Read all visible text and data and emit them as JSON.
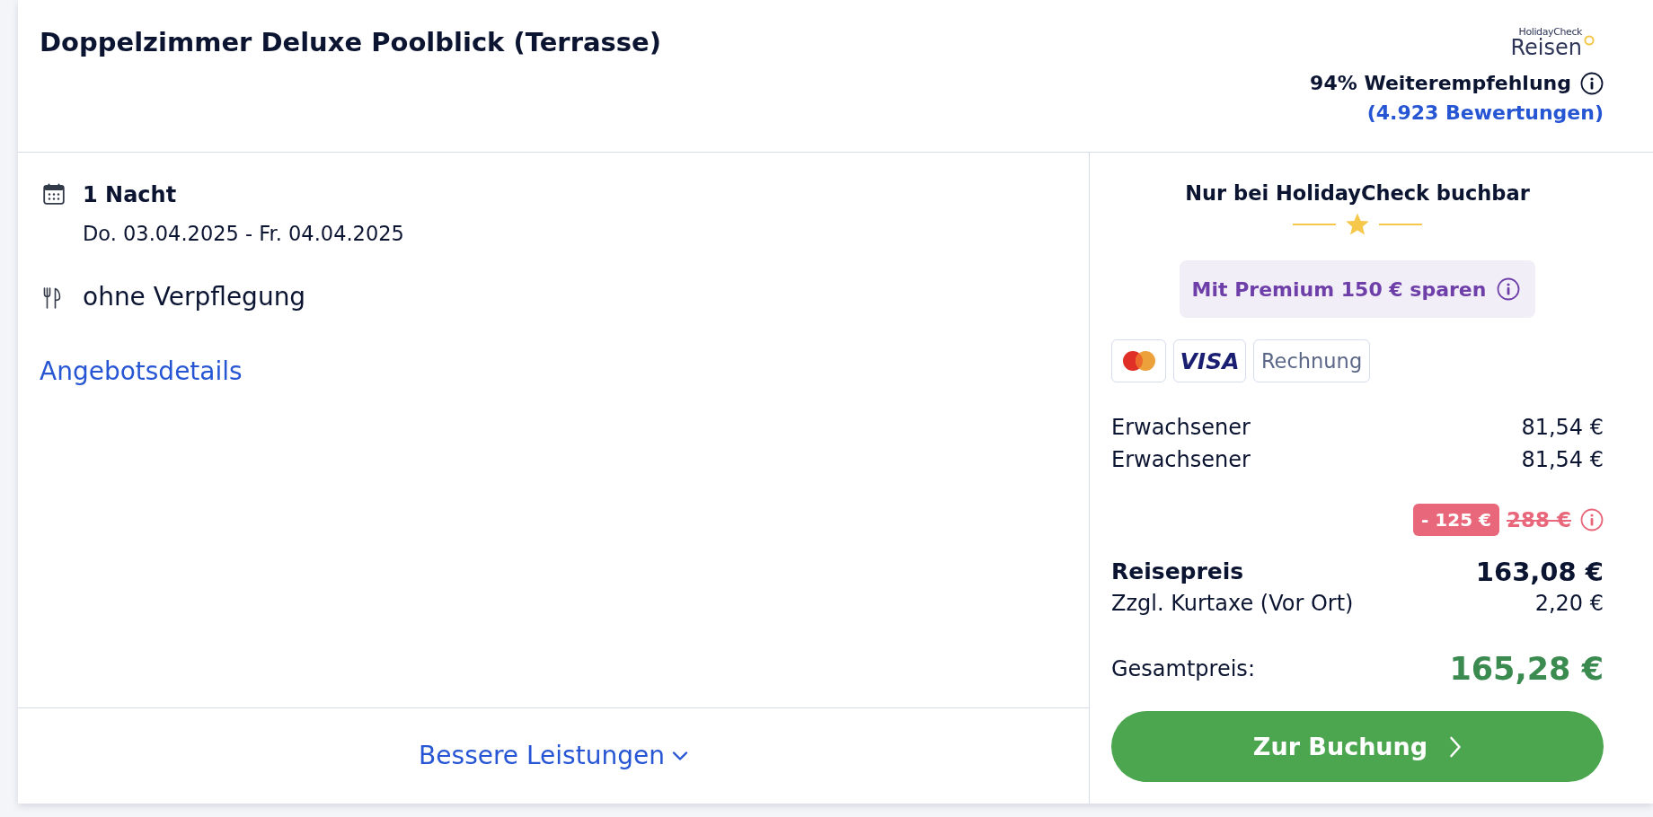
{
  "offer": {
    "title": "Doppelzimmer Deluxe Poolblick (Terrasse)"
  },
  "rating": {
    "brand_tagline": "HolidayCheck",
    "brand_name": "Reisen",
    "recommendation": "94% Weiterempfehlung",
    "reviews": "(4.923 Bewertungen)"
  },
  "details": [
    {
      "kind": "nights",
      "title": "1 Nacht",
      "subtitle": "Do. 03.04.2025 - Fr. 04.04.2025"
    },
    {
      "kind": "board",
      "title": "ohne Verpflegung"
    }
  ],
  "offer_link": "Angebotsdetails",
  "more_link": {
    "label": "Bessere Leistungen",
    "expanded": false
  },
  "booking": {
    "exclusive": "Nur bei HolidayCheck buchbar",
    "premium": "Mit Premium 150 € sparen",
    "payment_methods": [
      {
        "kind": "card_logo"
      },
      {
        "kind": "wordmark",
        "label": "VISA"
      },
      {
        "kind": "text",
        "label": "Rechnung"
      }
    ],
    "travellers": [
      {
        "label": "Erwachsener",
        "price": "81,54 €"
      },
      {
        "label": "Erwachsener",
        "price": "81,54 €"
      }
    ],
    "discount": {
      "amount": "- 125 €",
      "original": "288 €"
    },
    "travel_price": {
      "label": "Reisepreis",
      "value": "163,08 €"
    },
    "fee": {
      "label": "Zzgl. Kurtaxe (Vor Ort)",
      "value": "2,20 €"
    },
    "total": {
      "label": "Gesamtpreis:",
      "value": "165,28 €"
    },
    "button": "Zur Buchung"
  }
}
